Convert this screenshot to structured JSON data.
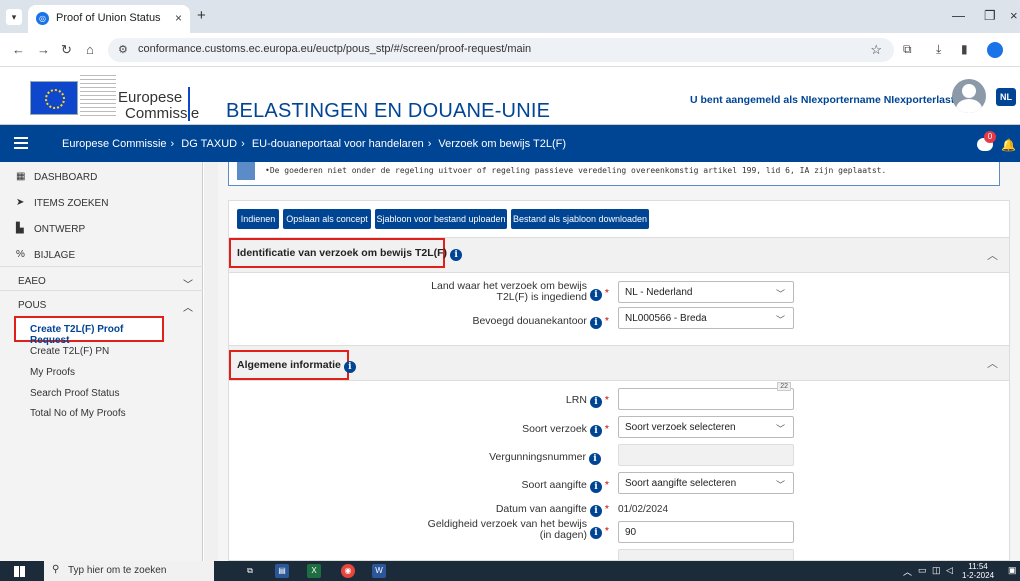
{
  "browser": {
    "tab_title": "Proof of Union Status",
    "url": "conformance.customs.ec.europa.eu/euctp/pous_stp/#/screen/proof-request/main"
  },
  "header": {
    "logo_line1": "Europese",
    "logo_line2": "Commissie",
    "title": "BELASTINGEN EN DOUANE-UNIE",
    "login_text": "U bent aangemeld als NIexportername NIexporterlastname",
    "lang": "NL",
    "notif_count": "0"
  },
  "breadcrumb": [
    "Europese Commissie",
    "DG TAXUD",
    "EU-douaneportaal voor handelaren",
    "Verzoek om bewijs T2L(F)"
  ],
  "sidebar": {
    "items": [
      {
        "label": "Dashboard",
        "icon": "dashboard-icon"
      },
      {
        "label": "Items zoeken",
        "icon": "send-icon"
      },
      {
        "label": "Ontwerp",
        "icon": "document-icon"
      },
      {
        "label": "Bijlage",
        "icon": "paperclip-icon"
      }
    ],
    "group_eaeo": "EAEO",
    "group_pous": "POUS",
    "pous_items": [
      "Create T2L(F) Proof Request",
      "Create T2L(F) PN",
      "My Proofs",
      "Search Proof Status",
      "Total No of My Proofs"
    ]
  },
  "notice": "•De goederen niet onder de regeling uitvoer of regeling passieve veredeling overeenkomstig artikel 199, lid 6, IA zijn geplaatst.",
  "toolbar": {
    "submit": "Indienen",
    "save_draft": "Opslaan als concept",
    "upload_template": "Sjabloon voor bestand uploaden",
    "download_template": "Bestand als sjabloon downloaden"
  },
  "section1": {
    "title": "Identificatie van verzoek om bewijs T2L(F)",
    "country_label_1": "Land waar het verzoek om bewijs",
    "country_label_2": "T2L(F) is ingediend",
    "country_value": "NL - Nederland",
    "office_label": "Bevoegd douanekantoor",
    "office_value": "NL000566 - Breda"
  },
  "section2": {
    "title": "Algemene informatie",
    "lrn_label": "LRN",
    "lrn_counter": "22",
    "type_label": "Soort verzoek",
    "type_value": "Soort verzoek selecteren",
    "permit_label": "Vergunningsnummer",
    "decl_type_label": "Soort aangifte",
    "decl_type_value": "Soort aangifte selecteren",
    "decl_date_label": "Datum van aangifte",
    "decl_date_value": "01/02/2024",
    "validity_label_1": "Geldigheid verzoek van het bewijs",
    "validity_label_2": "(in dagen)",
    "validity_value": "90"
  },
  "taskbar": {
    "search_placeholder": "Typ hier om te zoeken",
    "time": "11:54",
    "date": "1-2-2024"
  }
}
